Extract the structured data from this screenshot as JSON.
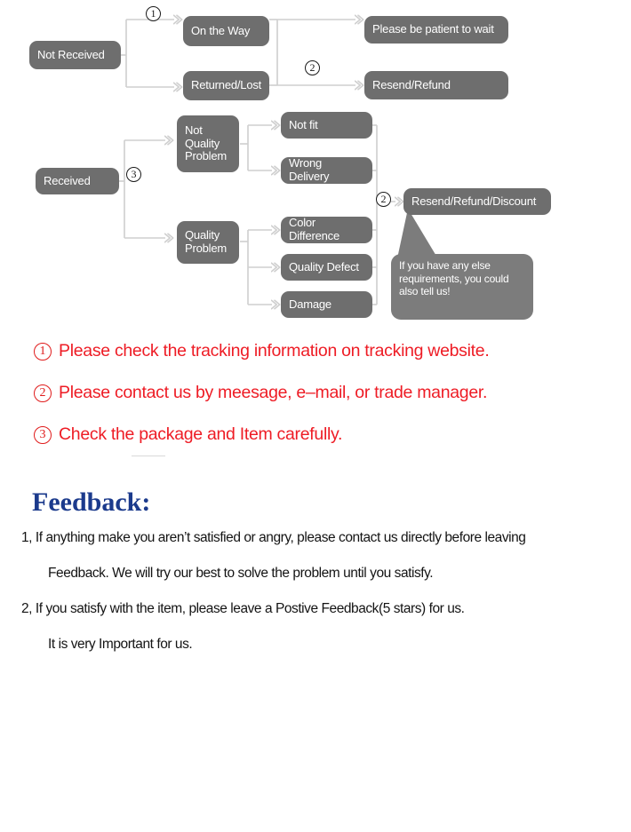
{
  "flowchart": {
    "nodes": {
      "not_received": "Not Received",
      "on_the_way": "On the Way",
      "returned_lost": "Returned/Lost",
      "please_wait": "Please be patient to wait",
      "resend_refund": "Resend/Refund",
      "received": "Received",
      "not_quality_problem": "Not\nQuality\nProblem",
      "quality_problem": "Quality\nProblem",
      "not_fit": "Not fit",
      "wrong_delivery": "Wrong Delivery",
      "color_difference": "Color Difference",
      "quality_defect": "Quality Defect",
      "damage": "Damage",
      "resend_refund_discount": "Resend/Refund/Discount"
    },
    "bubble": "If you have any else requirements, you could also tell us!",
    "markers": {
      "m1": "1",
      "m2_top": "2",
      "m3": "3",
      "m2_bottom": "2"
    },
    "colors": {
      "node_fill": "#6e6e6e",
      "bubble_fill": "#7c7c7c",
      "connector": "#cfcfcf",
      "node_text": "#ffffff"
    }
  },
  "notes": {
    "items": [
      {
        "marker": "1",
        "text": "Please check the tracking information on tracking website."
      },
      {
        "marker": "2",
        "text": "Please contact us by meesage, e–mail, or trade manager."
      },
      {
        "marker": "3",
        "text": "Check the package and Item carefully."
      }
    ],
    "color": "#ee1c25"
  },
  "feedback": {
    "title": "Feedback:",
    "title_color": "#1b3a8c",
    "lines": [
      {
        "indent": 1,
        "text": "1, If anything make you aren’t satisfied or angry, please contact us directly before leaving"
      },
      {
        "indent": 2,
        "text": "Feedback. We will try our best to solve the problem until you satisfy."
      },
      {
        "indent": 1,
        "text": "2, If you satisfy with the item, please leave a Postive Feedback(5 stars) for us."
      },
      {
        "indent": 2,
        "text": "It is very Important for us."
      }
    ]
  }
}
